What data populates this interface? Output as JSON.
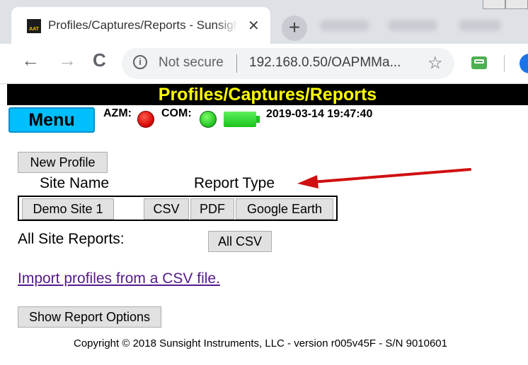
{
  "browser": {
    "tab_title": "Profiles/Captures/Reports - Sunsight",
    "favicon_text": "AAT",
    "tab_close": "✕",
    "new_tab": "+",
    "back": "←",
    "forward": "→",
    "reload": "C",
    "info_glyph": "i",
    "security_label": "Not secure",
    "url": "192.168.0.50/OAPMMa...",
    "bookmark_star": "☆"
  },
  "page": {
    "title": "Profiles/Captures/Reports",
    "menu_label": "Menu",
    "status": {
      "azm_label": "AZM:",
      "azm_color": "#e00000",
      "com_label": "COM:",
      "com_color": "#1fbf1f",
      "datetime": "2019-03-14 19:47:40"
    },
    "new_profile_button": "New Profile",
    "headers": {
      "site_name": "Site Name",
      "report_type": "Report Type"
    },
    "profiles": [
      {
        "site_name": "Demo Site 1",
        "buttons": [
          "CSV",
          "PDF",
          "Google Earth"
        ]
      }
    ],
    "all_site_reports_label": "All Site Reports:",
    "all_csv_button": "All CSV",
    "import_link": "Import profiles from a CSV file.",
    "show_report_options_button": "Show Report Options",
    "copyright": "Copyright © 2018 Sunsight Instruments, LLC - version r005v45F - S/N 9010601"
  },
  "annotation": {
    "arrow_color": "#d01010"
  }
}
